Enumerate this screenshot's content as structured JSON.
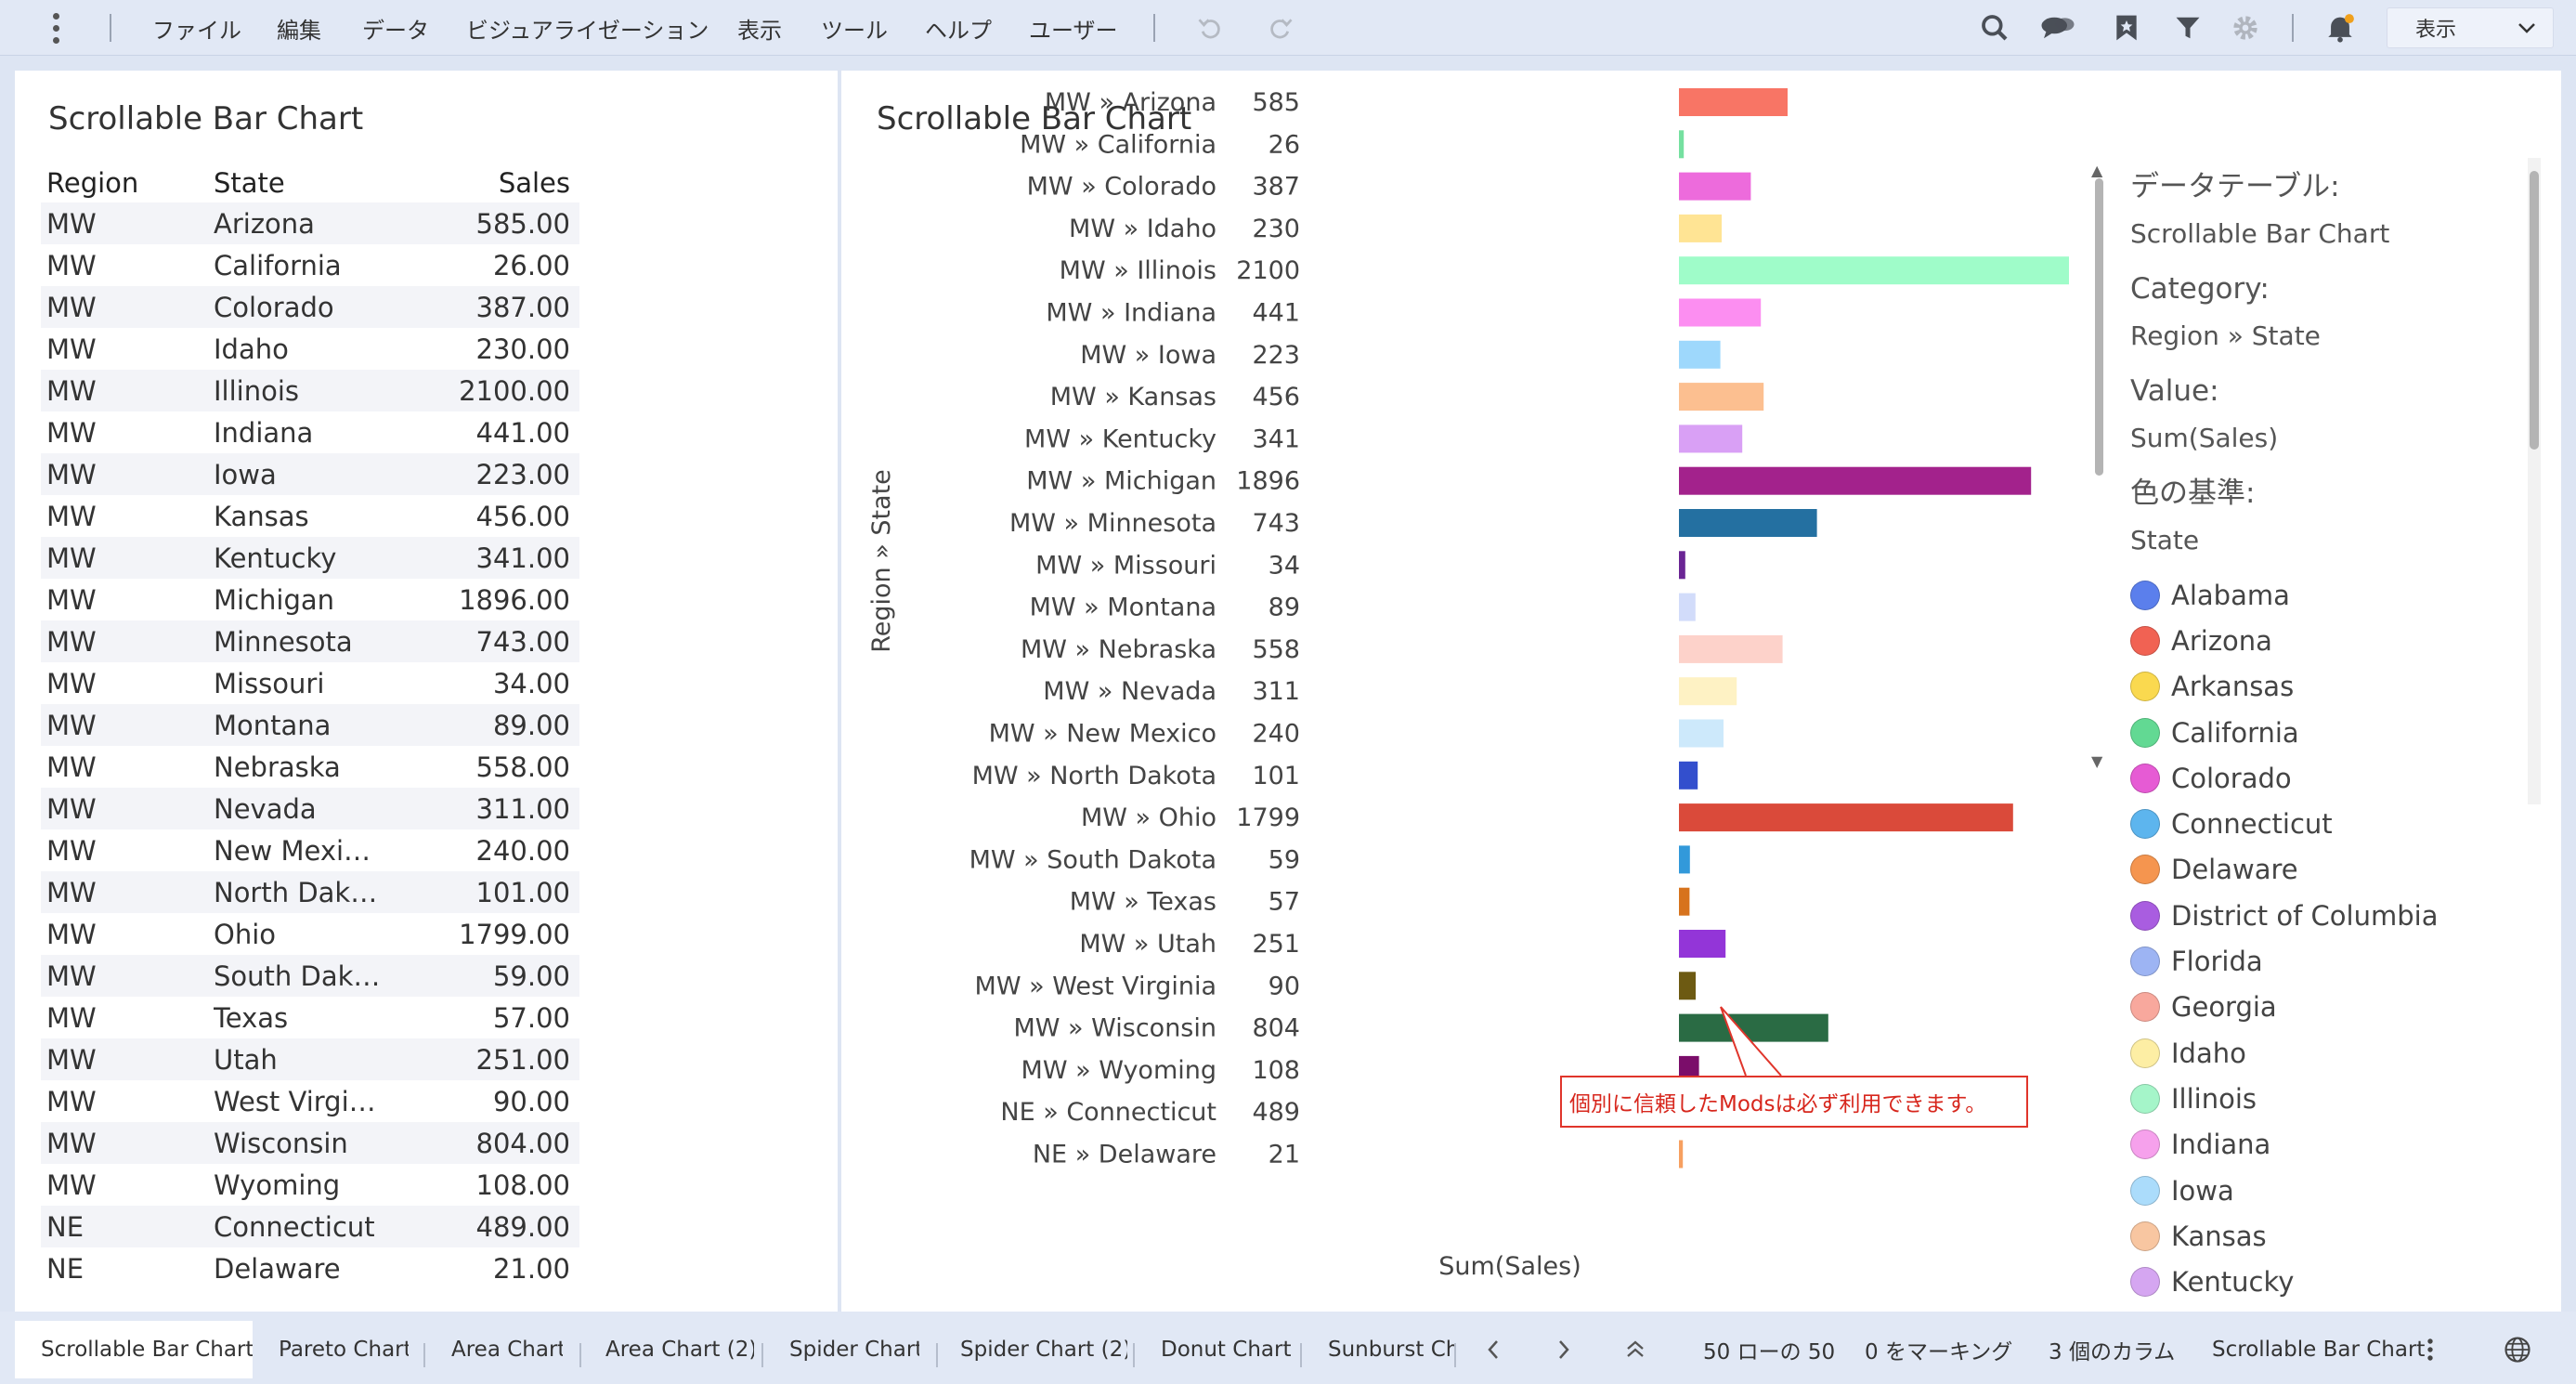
{
  "toolbar": {
    "menu": [
      "ファイル",
      "編集",
      "データ",
      "ビジュアライゼーション",
      "表示",
      "ツール",
      "ヘルプ",
      "ユーザー"
    ],
    "view_select": "表示"
  },
  "left_panel": {
    "title": "Scrollable Bar Chart",
    "columns": {
      "region": "Region",
      "state": "State",
      "sales": "Sales"
    },
    "rows": [
      {
        "region": "MW",
        "state": "Arizona",
        "sales": "585.00"
      },
      {
        "region": "MW",
        "state": "California",
        "sales": "26.00"
      },
      {
        "region": "MW",
        "state": "Colorado",
        "sales": "387.00"
      },
      {
        "region": "MW",
        "state": "Idaho",
        "sales": "230.00"
      },
      {
        "region": "MW",
        "state": "Illinois",
        "sales": "2100.00"
      },
      {
        "region": "MW",
        "state": "Indiana",
        "sales": "441.00"
      },
      {
        "region": "MW",
        "state": "Iowa",
        "sales": "223.00"
      },
      {
        "region": "MW",
        "state": "Kansas",
        "sales": "456.00"
      },
      {
        "region": "MW",
        "state": "Kentucky",
        "sales": "341.00"
      },
      {
        "region": "MW",
        "state": "Michigan",
        "sales": "1896.00"
      },
      {
        "region": "MW",
        "state": "Minnesota",
        "sales": "743.00"
      },
      {
        "region": "MW",
        "state": "Missouri",
        "sales": "34.00"
      },
      {
        "region": "MW",
        "state": "Montana",
        "sales": "89.00"
      },
      {
        "region": "MW",
        "state": "Nebraska",
        "sales": "558.00"
      },
      {
        "region": "MW",
        "state": "Nevada",
        "sales": "311.00"
      },
      {
        "region": "MW",
        "state": "New Mexi…",
        "sales": "240.00"
      },
      {
        "region": "MW",
        "state": "North Dak…",
        "sales": "101.00"
      },
      {
        "region": "MW",
        "state": "Ohio",
        "sales": "1799.00"
      },
      {
        "region": "MW",
        "state": "South Dak…",
        "sales": "59.00"
      },
      {
        "region": "MW",
        "state": "Texas",
        "sales": "57.00"
      },
      {
        "region": "MW",
        "state": "Utah",
        "sales": "251.00"
      },
      {
        "region": "MW",
        "state": "West Virgi…",
        "sales": "90.00"
      },
      {
        "region": "MW",
        "state": "Wisconsin",
        "sales": "804.00"
      },
      {
        "region": "MW",
        "state": "Wyoming",
        "sales": "108.00"
      },
      {
        "region": "NE",
        "state": "Connecticut",
        "sales": "489.00"
      },
      {
        "region": "NE",
        "state": "Delaware",
        "sales": "21.00"
      }
    ]
  },
  "right_panel": {
    "title": "Scrollable Bar Chart",
    "callout": "個別に信頼したModsは必ず利用できます。"
  },
  "chart_data": {
    "type": "bar",
    "orientation": "horizontal",
    "title": "Scrollable Bar Chart",
    "ylabel": "Region » State",
    "xlabel": "Sum(Sales)",
    "data_labels": true,
    "categories": [
      "MW » Arizona",
      "MW » California",
      "MW » Colorado",
      "MW » Idaho",
      "MW » Illinois",
      "MW » Indiana",
      "MW » Iowa",
      "MW » Kansas",
      "MW » Kentucky",
      "MW » Michigan",
      "MW » Minnesota",
      "MW » Missouri",
      "MW » Montana",
      "MW » Nebraska",
      "MW » Nevada",
      "MW » New Mexico",
      "MW » North Dakota",
      "MW » Ohio",
      "MW » South Dakota",
      "MW » Texas",
      "MW » Utah",
      "MW » West Virginia",
      "MW » Wisconsin",
      "MW » Wyoming",
      "NE » Connecticut",
      "NE » Delaware"
    ],
    "values": [
      585,
      26,
      387,
      230,
      2100,
      441,
      223,
      456,
      341,
      1896,
      743,
      34,
      89,
      558,
      311,
      240,
      101,
      1799,
      59,
      57,
      251,
      90,
      804,
      108,
      489,
      21
    ],
    "colors": [
      "#f87565",
      "#75e0a0",
      "#ed6bdc",
      "#ffe494",
      "#9ffcc9",
      "#fc8ef1",
      "#9ed8fc",
      "#fcbf90",
      "#d9a0f5",
      "#a3228c",
      "#2470a1",
      "#6a2594",
      "#d2dcfa",
      "#fdd2ca",
      "#fef2c4",
      "#cde9fb",
      "#334fcd",
      "#da4a3a",
      "#3299da",
      "#d7731d",
      "#9335d8",
      "#6d5a12",
      "#2a6b44",
      "#7b0d6a",
      "#6ebcf0",
      "#f7a060"
    ],
    "xlim": [
      0,
      2100
    ],
    "legend_position": "right"
  },
  "legend": {
    "data_table_label": "データテーブル:",
    "data_table_value": "Scrollable Bar Chart",
    "category_label": "Category:",
    "category_value": "Region » State",
    "value_label": "Value:",
    "value_value": "Sum(Sales)",
    "color_by_label": "色の基準:",
    "color_by_value": "State",
    "items": [
      {
        "name": "Alabama",
        "color": "#5b7fec"
      },
      {
        "name": "Arizona",
        "color": "#f16253"
      },
      {
        "name": "Arkansas",
        "color": "#fad94f"
      },
      {
        "name": "California",
        "color": "#62d993"
      },
      {
        "name": "Colorado",
        "color": "#e65bd4"
      },
      {
        "name": "Connecticut",
        "color": "#5db5ee"
      },
      {
        "name": "Delaware",
        "color": "#f5954f"
      },
      {
        "name": "District of Columbia",
        "color": "#a95de0"
      },
      {
        "name": "Florida",
        "color": "#9db4f3"
      },
      {
        "name": "Georgia",
        "color": "#f8a89d"
      },
      {
        "name": "Idaho",
        "color": "#fdeea4"
      },
      {
        "name": "Illinois",
        "color": "#a5f5c9"
      },
      {
        "name": "Indiana",
        "color": "#f6a1ec"
      },
      {
        "name": "Iowa",
        "color": "#abdcfb"
      },
      {
        "name": "Kansas",
        "color": "#f8c6a1"
      },
      {
        "name": "Kentucky",
        "color": "#d5a6f1"
      }
    ]
  },
  "tabs": [
    "Scrollable Bar Chart",
    "Pareto Chart",
    "Area Chart",
    "Area Chart (2)",
    "Spider Chart",
    "Spider Chart (2)",
    "Donut Chart",
    "Sunburst Chart"
  ],
  "status": {
    "rows": "50 ローの 50",
    "marked": "0 をマーキング",
    "columns": "3 個のカラム",
    "current": "Scrollable Bar Chart"
  }
}
